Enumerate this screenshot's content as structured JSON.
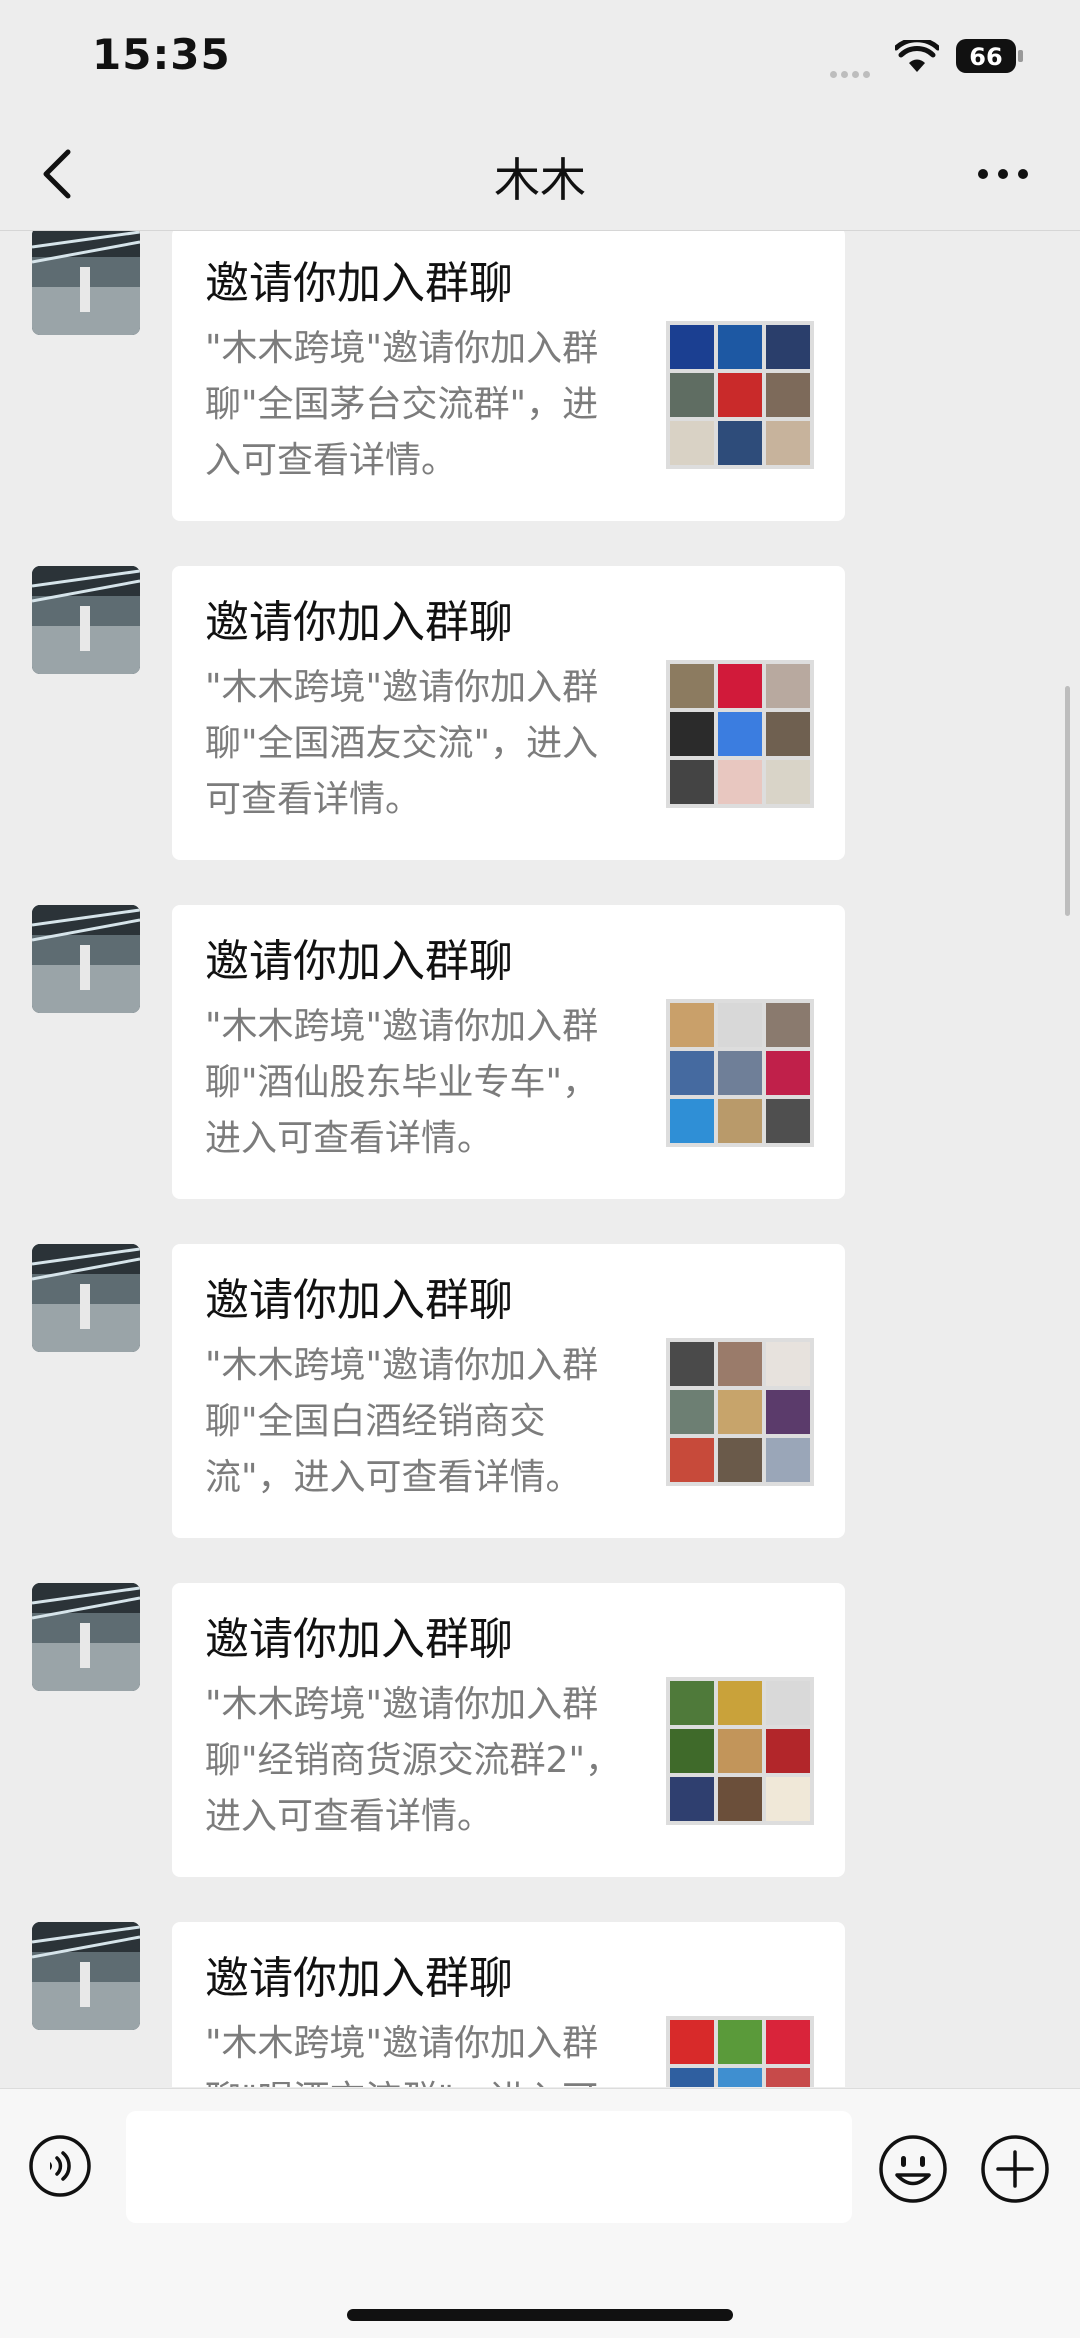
{
  "status_bar": {
    "time": "15:35",
    "battery": "66"
  },
  "nav": {
    "title": "木木"
  },
  "messages": [
    {
      "title": "邀请你加入群聊",
      "desc": "\"木木跨境\"邀请你加入群聊\"全国茅台交流群\"，进入可查看详情。",
      "thumb_colors": [
        "#1b3f91",
        "#1d58a3",
        "#2a3e6b",
        "#5f6d62",
        "#c92a2a",
        "#7d6a5a",
        "#d9d2c5",
        "#2e4c7a",
        "#c7b39c"
      ]
    },
    {
      "title": "邀请你加入群聊",
      "desc": "\"木木跨境\"邀请你加入群聊\"全国酒友交流\"，进入可查看详情。",
      "thumb_colors": [
        "#8c7b60",
        "#d11a3a",
        "#b8a99f",
        "#2b2b2b",
        "#3b7de0",
        "#6f6050",
        "#444444",
        "#e8c7c0",
        "#d9d4c8"
      ]
    },
    {
      "title": "邀请你加入群聊",
      "desc": "\"木木跨境\"邀请你加入群聊\"酒仙股东毕业专车\"，进入可查看详情。",
      "thumb_colors": [
        "#c9a06a",
        "#d8d8d8",
        "#8a7a6e",
        "#456aa0",
        "#6f7f98",
        "#c0204a",
        "#2f8fd6",
        "#b99a6a",
        "#4f4f4f"
      ]
    },
    {
      "title": "邀请你加入群聊",
      "desc": "\"木木跨境\"邀请你加入群聊\"全国白酒经销商交流\"，进入可查看详情。",
      "thumb_colors": [
        "#4a4a4a",
        "#9a7b6a",
        "#e7e2dd",
        "#6d7f73",
        "#c7a46b",
        "#5b3b6b",
        "#c74a3a",
        "#6a5a4a",
        "#9aa6b8"
      ]
    },
    {
      "title": "邀请你加入群聊",
      "desc": "\"木木跨境\"邀请你加入群聊\"经销商货源交流群2\"，进入可查看详情。",
      "thumb_colors": [
        "#4f7a3a",
        "#c9a23a",
        "#d9d9d9",
        "#3f6a2a",
        "#c2955a",
        "#b2262a",
        "#2f3f6f",
        "#6b4f3a",
        "#f0e8d8"
      ]
    },
    {
      "title": "邀请你加入群聊",
      "desc": "\"木木跨境\"邀请你加入群聊\"喝酒交流群\"，进入可查看详情。",
      "thumb_colors": [
        "#d82a2a",
        "#5a9a3a",
        "#d9243a",
        "#2f5fa0",
        "#3f8fd0",
        "#c74a4a",
        "#d0d0d0",
        "#d0d0d0",
        "#d0d0d0"
      ]
    }
  ],
  "input_bar": {
    "placeholder": ""
  }
}
